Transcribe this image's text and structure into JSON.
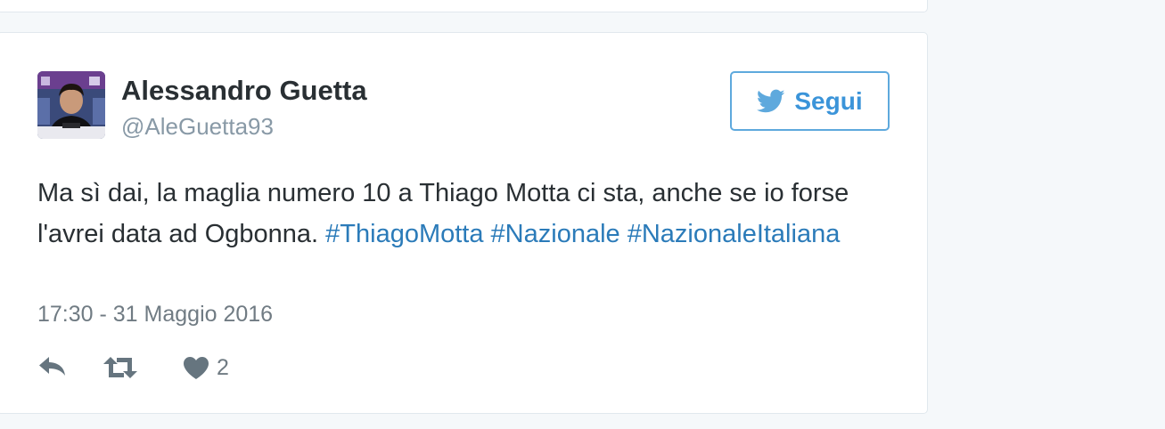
{
  "tweet": {
    "author_name": "Alessandro Guetta",
    "author_handle": "@AleGuetta93",
    "follow_label": "Segui",
    "text": "Ma sì dai, la maglia numero 10 a Thiago Motta ci sta, anche se io forse l'avrei data ad Ogbonna.",
    "hashtags": [
      "#ThiagoMotta",
      "#Nazionale",
      "#NazionaleItaliana"
    ],
    "timestamp": "17:30 - 31 Maggio 2016",
    "like_count": "2"
  },
  "icons": {
    "follow": "twitter-bird-icon",
    "reply": "reply-icon",
    "retweet": "retweet-icon",
    "like": "heart-icon"
  },
  "colors": {
    "link": "#2b7bb9",
    "follow_border": "#5ea9dd",
    "follow_text": "#3b94d9",
    "text": "#292f33",
    "muted": "#8899a6",
    "action_icon": "#66757f"
  }
}
